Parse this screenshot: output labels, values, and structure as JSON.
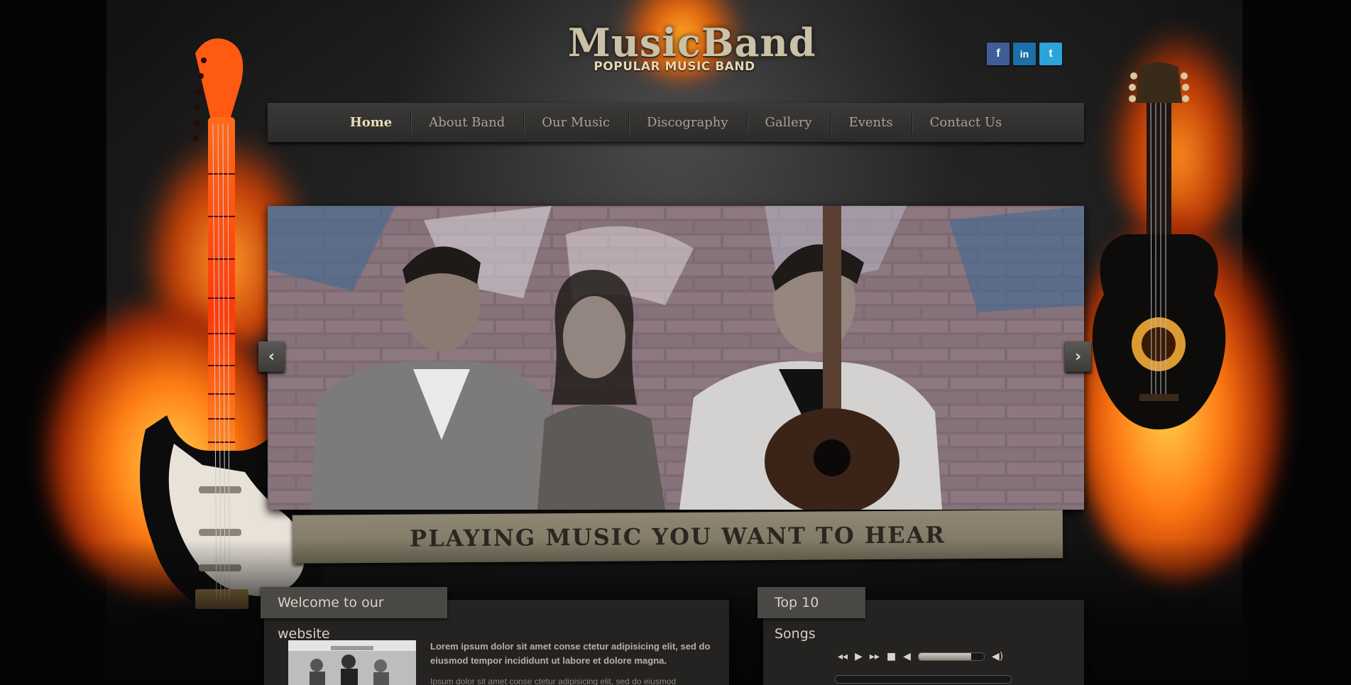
{
  "header": {
    "logo_title": "MusicBand",
    "logo_subtitle": "POPULAR MUSIC BAND"
  },
  "social": [
    {
      "label": "f",
      "icon": "facebook-icon",
      "color": "#3f5e98"
    },
    {
      "label": "in",
      "icon": "linkedin-icon",
      "color": "#1c6fa7"
    },
    {
      "label": "t",
      "icon": "twitter-icon",
      "color": "#2aa4d9"
    }
  ],
  "nav": {
    "items": [
      {
        "label": "Home",
        "active": true
      },
      {
        "label": "About Band",
        "active": false
      },
      {
        "label": "Our Music",
        "active": false
      },
      {
        "label": "Discography",
        "active": false
      },
      {
        "label": "Gallery",
        "active": false
      },
      {
        "label": "Events",
        "active": false
      },
      {
        "label": "Contact Us",
        "active": false
      }
    ]
  },
  "slider": {
    "prev_icon": "chevron-left-icon",
    "next_icon": "chevron-right-icon",
    "prev_label": "‹",
    "next_label": "›",
    "banner_text": "PLAYING MUSIC YOU WANT TO HEAR"
  },
  "welcome": {
    "title": "Welcome to our website",
    "lead": "Lorem ipsum dolor sit amet conse ctetur adipisicing elit, sed do eiusmod tempor incididunt ut labore et dolore magna.",
    "body": "Ipsum dolor sit amet conse ctetur adipisicing elit, sed do eiusmod"
  },
  "songs": {
    "title": "Top 10 Songs",
    "player": {
      "controls": [
        "rewind-icon",
        "play-icon",
        "fast-forward-icon",
        "stop-icon",
        "mute-icon",
        "volume-icon"
      ],
      "volume_fraction": 0.8,
      "progress_fraction": 0
    }
  },
  "colors": {
    "accent": "#e9dcb8",
    "nav_text": "#a8a196",
    "banner": "#8f8773",
    "panel": "#242322"
  }
}
